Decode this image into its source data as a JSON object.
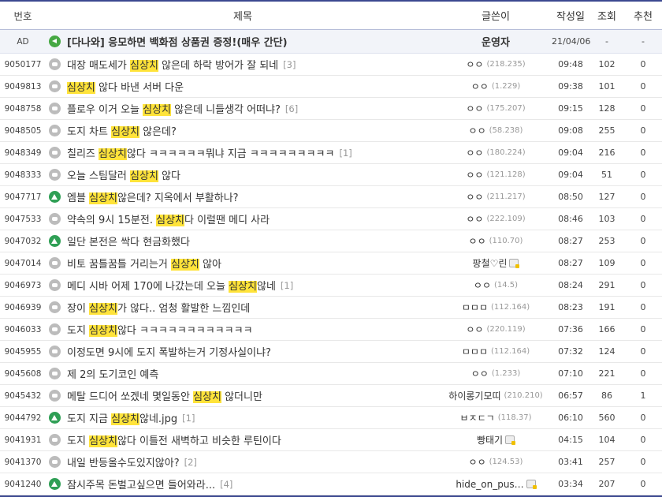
{
  "header": {
    "num": "번호",
    "title": "제목",
    "writer": "글쓴이",
    "date": "작성일",
    "views": "조회",
    "recommend": "추천"
  },
  "ad": {
    "num": "AD",
    "icon": "speaker-icon",
    "title": "[다나와] 응모하면 백화점 상품권 증정!(매우 간단)",
    "writer": "운영자",
    "date": "21/04/06",
    "views": "-",
    "recommend": "-"
  },
  "posts": [
    {
      "num": "9050177",
      "icon": "speech-bubble-icon",
      "pre": "대장 매도세가 ",
      "hl": "심상치",
      "post": " 않은데 하락 방어가 잘 되네",
      "reply": "[3]",
      "writer": "ㅇㅇ",
      "ip": "(218.235)",
      "badge": false,
      "date": "09:48",
      "views": "102",
      "recommend": "0"
    },
    {
      "num": "9049813",
      "icon": "speech-bubble-icon",
      "pre": "",
      "hl": "심상치",
      "post": " 않다 바낸 서버 다운",
      "reply": "",
      "writer": "ㅇㅇ",
      "ip": "(1.229)",
      "badge": false,
      "date": "09:38",
      "views": "101",
      "recommend": "0"
    },
    {
      "num": "9048758",
      "icon": "speech-bubble-icon",
      "pre": "플로우 이거 오늘 ",
      "hl": "심상치",
      "post": " 않은데 니들생각 어떠냐?",
      "reply": "[6]",
      "writer": "ㅇㅇ",
      "ip": "(175.207)",
      "badge": false,
      "date": "09:15",
      "views": "128",
      "recommend": "0"
    },
    {
      "num": "9048505",
      "icon": "speech-bubble-icon",
      "pre": "도지 차트 ",
      "hl": "심상치",
      "post": " 않은데?",
      "reply": "",
      "writer": "ㅇㅇ",
      "ip": "(58.238)",
      "badge": false,
      "date": "09:08",
      "views": "255",
      "recommend": "0"
    },
    {
      "num": "9048349",
      "icon": "speech-bubble-icon",
      "pre": "칠리즈 ",
      "hl": "심상치",
      "post": "않다 ㅋㅋㅋㅋㅋㅋ뭐냐 지금 ㅋㅋㅋㅋㅋㅋㅋㅋㅋ",
      "reply": "[1]",
      "writer": "ㅇㅇ",
      "ip": "(180.224)",
      "badge": false,
      "date": "09:04",
      "views": "216",
      "recommend": "0"
    },
    {
      "num": "9048333",
      "icon": "speech-bubble-icon",
      "pre": "오늘 스팀달러 ",
      "hl": "심상치",
      "post": " 않다",
      "reply": "",
      "writer": "ㅇㅇ",
      "ip": "(121.128)",
      "badge": false,
      "date": "09:04",
      "views": "51",
      "recommend": "0"
    },
    {
      "num": "9047717",
      "icon": "image-icon",
      "pre": "엠블 ",
      "hl": "심상치",
      "post": "않은데? 지옥에서 부활하나?",
      "reply": "",
      "writer": "ㅇㅇ",
      "ip": "(211.217)",
      "badge": false,
      "date": "08:50",
      "views": "127",
      "recommend": "0"
    },
    {
      "num": "9047533",
      "icon": "speech-bubble-icon",
      "pre": "약속의 9시 15분전. ",
      "hl": "심상치",
      "post": "다 이럴땐 메디 사라",
      "reply": "",
      "writer": "ㅇㅇ",
      "ip": "(222.109)",
      "badge": false,
      "date": "08:46",
      "views": "103",
      "recommend": "0"
    },
    {
      "num": "9047032",
      "icon": "image-icon",
      "pre": "일단 본전은 싹다 현금화했다",
      "hl": "",
      "post": "",
      "reply": "",
      "writer": "ㅇㅇ",
      "ip": "(110.70)",
      "badge": false,
      "date": "08:27",
      "views": "253",
      "recommend": "0"
    },
    {
      "num": "9047014",
      "icon": "speech-bubble-icon",
      "pre": "비토 꿈틀꿈틀 거리는거 ",
      "hl": "심상치",
      "post": " 않아",
      "reply": "",
      "writer": "팡철♡린",
      "ip": "",
      "badge": true,
      "date": "08:27",
      "views": "109",
      "recommend": "0"
    },
    {
      "num": "9046973",
      "icon": "speech-bubble-icon",
      "pre": "메디 시바 어제 170에 나갔는데 오늘 ",
      "hl": "심상치",
      "post": "않네",
      "reply": "[1]",
      "writer": "ㅇㅇ",
      "ip": "(14.5)",
      "badge": false,
      "date": "08:24",
      "views": "291",
      "recommend": "0"
    },
    {
      "num": "9046939",
      "icon": "speech-bubble-icon",
      "pre": "장이 ",
      "hl": "심상치",
      "post": "가 않다.. 엄청 활발한 느낌인데",
      "reply": "",
      "writer": "ㅁㅁㅁ",
      "ip": "(112.164)",
      "badge": false,
      "date": "08:23",
      "views": "191",
      "recommend": "0"
    },
    {
      "num": "9046033",
      "icon": "speech-bubble-icon",
      "pre": "도지 ",
      "hl": "심상치",
      "post": "않다 ㅋㅋㅋㅋㅋㅋㅋㅋㅋㅋㅋㅋ",
      "reply": "",
      "writer": "ㅇㅇ",
      "ip": "(220.119)",
      "badge": false,
      "date": "07:36",
      "views": "166",
      "recommend": "0"
    },
    {
      "num": "9045955",
      "icon": "speech-bubble-icon",
      "pre": "이정도면 9시에 도지 폭발하는거 기정사실이냐?",
      "hl": "",
      "post": "",
      "reply": "",
      "writer": "ㅁㅁㅁ",
      "ip": "(112.164)",
      "badge": false,
      "date": "07:32",
      "views": "124",
      "recommend": "0"
    },
    {
      "num": "9045608",
      "icon": "speech-bubble-icon",
      "pre": "제 2의 도기코인 예측",
      "hl": "",
      "post": "",
      "reply": "",
      "writer": "ㅇㅇ",
      "ip": "(1.233)",
      "badge": false,
      "date": "07:10",
      "views": "221",
      "recommend": "0"
    },
    {
      "num": "9045432",
      "icon": "speech-bubble-icon",
      "pre": "메탈 드디어 쏘겠네 몇일동안 ",
      "hl": "심상치",
      "post": " 않더니만",
      "reply": "",
      "writer": "하이롱기모띠",
      "ip": "(210.210)",
      "badge": false,
      "date": "06:57",
      "views": "86",
      "recommend": "1"
    },
    {
      "num": "9044792",
      "icon": "image-icon",
      "pre": "도지 지금 ",
      "hl": "심상치",
      "post": "않네.jpg",
      "reply": "[1]",
      "writer": "ㅂㅈㄷㄱ",
      "ip": "(118.37)",
      "badge": false,
      "date": "06:10",
      "views": "560",
      "recommend": "0"
    },
    {
      "num": "9041931",
      "icon": "speech-bubble-icon",
      "pre": "도지 ",
      "hl": "심상치",
      "post": "않다 이틀전 새벽하고 비슷한 루틴이다",
      "reply": "",
      "writer": "빵태기",
      "ip": "",
      "badge": true,
      "date": "04:15",
      "views": "104",
      "recommend": "0"
    },
    {
      "num": "9041370",
      "icon": "speech-bubble-icon",
      "pre": "내일 반등올수도있지않아?",
      "hl": "",
      "post": "",
      "reply": "[2]",
      "writer": "ㅇㅇ",
      "ip": "(124.53)",
      "badge": false,
      "date": "03:41",
      "views": "257",
      "recommend": "0"
    },
    {
      "num": "9041240",
      "icon": "image-icon",
      "pre": "잠시주목 돈벌고싶으면 들어와라...",
      "hl": "",
      "post": "",
      "reply": "[4]",
      "writer": "hide_on_pus…",
      "ip": "",
      "badge": true,
      "date": "03:34",
      "views": "207",
      "recommend": "0"
    }
  ],
  "colors": {
    "highlight": "#ffe33a",
    "header_rule": "#3b4890",
    "speech_icon": "#bcbcbc",
    "image_icon": "#2f9f55",
    "speaker_icon": "#46a843"
  }
}
